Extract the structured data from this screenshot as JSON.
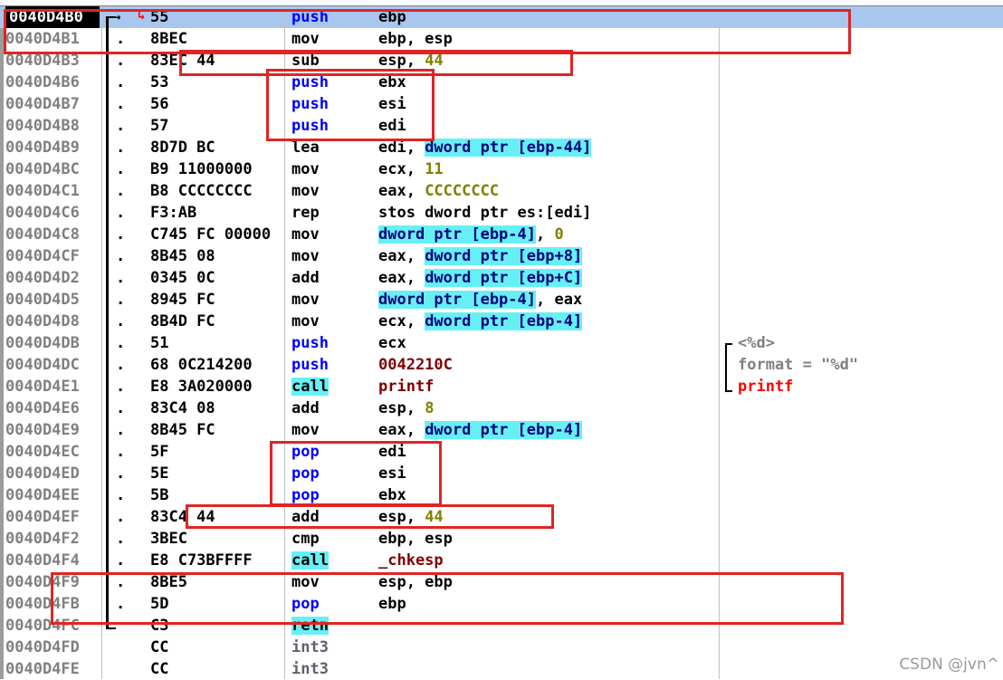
{
  "rows": [
    {
      "addr": "0040D4B0",
      "dot": "",
      "hex": "55",
      "mnem": "push",
      "ops": "ebp",
      "selected": true
    },
    {
      "addr": "0040D4B1",
      "dot": ".",
      "hex": "8BEC",
      "mnem": "mov",
      "ops": "ebp, esp"
    },
    {
      "addr": "0040D4B3",
      "dot": ".",
      "hex": "83EC 44",
      "mnem": "sub",
      "ops": "esp, 44"
    },
    {
      "addr": "0040D4B6",
      "dot": ".",
      "hex": "53",
      "mnem": "push",
      "ops": "ebx"
    },
    {
      "addr": "0040D4B7",
      "dot": ".",
      "hex": "56",
      "mnem": "push",
      "ops": "esi"
    },
    {
      "addr": "0040D4B8",
      "dot": ".",
      "hex": "57",
      "mnem": "push",
      "ops": "edi"
    },
    {
      "addr": "0040D4B9",
      "dot": ".",
      "hex": "8D7D BC",
      "mnem": "lea",
      "ops": "edi, dword ptr [ebp-44]"
    },
    {
      "addr": "0040D4BC",
      "dot": ".",
      "hex": "B9 11000000",
      "mnem": "mov",
      "ops": "ecx, 11"
    },
    {
      "addr": "0040D4C1",
      "dot": ".",
      "hex": "B8 CCCCCCCC",
      "mnem": "mov",
      "ops": "eax, CCCCCCCC"
    },
    {
      "addr": "0040D4C6",
      "dot": ".",
      "hex": "F3:AB",
      "mnem": "rep",
      "ops": "stos dword ptr es:[edi]"
    },
    {
      "addr": "0040D4C8",
      "dot": ".",
      "hex": "C745 FC 00000",
      "mnem": "mov",
      "ops": "dword ptr [ebp-4], 0"
    },
    {
      "addr": "0040D4CF",
      "dot": ".",
      "hex": "8B45 08",
      "mnem": "mov",
      "ops": "eax, dword ptr [ebp+8]"
    },
    {
      "addr": "0040D4D2",
      "dot": ".",
      "hex": "0345 0C",
      "mnem": "add",
      "ops": "eax, dword ptr [ebp+C]"
    },
    {
      "addr": "0040D4D5",
      "dot": ".",
      "hex": "8945 FC",
      "mnem": "mov",
      "ops": "dword ptr [ebp-4], eax"
    },
    {
      "addr": "0040D4D8",
      "dot": ".",
      "hex": "8B4D FC",
      "mnem": "mov",
      "ops": "ecx, dword ptr [ebp-4]"
    },
    {
      "addr": "0040D4DB",
      "dot": ".",
      "hex": "51",
      "mnem": "push",
      "ops": "ecx",
      "comment": "<%d>"
    },
    {
      "addr": "0040D4DC",
      "dot": ".",
      "hex": "68 0C214200",
      "mnem": "push",
      "ops": "0042210C",
      "comment": "format = \"%d\""
    },
    {
      "addr": "0040D4E1",
      "dot": ".",
      "hex": "E8 3A020000",
      "mnem": "call",
      "ops": "printf",
      "comment": "printf"
    },
    {
      "addr": "0040D4E6",
      "dot": ".",
      "hex": "83C4 08",
      "mnem": "add",
      "ops": "esp, 8"
    },
    {
      "addr": "0040D4E9",
      "dot": ".",
      "hex": "8B45 FC",
      "mnem": "mov",
      "ops": "eax, dword ptr [ebp-4]"
    },
    {
      "addr": "0040D4EC",
      "dot": ".",
      "hex": "5F",
      "mnem": "pop",
      "ops": "edi"
    },
    {
      "addr": "0040D4ED",
      "dot": ".",
      "hex": "5E",
      "mnem": "pop",
      "ops": "esi"
    },
    {
      "addr": "0040D4EE",
      "dot": ".",
      "hex": "5B",
      "mnem": "pop",
      "ops": "ebx"
    },
    {
      "addr": "0040D4EF",
      "dot": ".",
      "hex": "83C4 44",
      "mnem": "add",
      "ops": "esp, 44"
    },
    {
      "addr": "0040D4F2",
      "dot": ".",
      "hex": "3BEC",
      "mnem": "cmp",
      "ops": "ebp, esp"
    },
    {
      "addr": "0040D4F4",
      "dot": ".",
      "hex": "E8 C73BFFFF",
      "mnem": "call",
      "ops": "_chkesp"
    },
    {
      "addr": "0040D4F9",
      "dot": ".",
      "hex": "8BE5",
      "mnem": "mov",
      "ops": "esp, ebp"
    },
    {
      "addr": "0040D4FB",
      "dot": ".",
      "hex": "5D",
      "mnem": "pop",
      "ops": "ebp"
    },
    {
      "addr": "0040D4FC",
      "dot": "",
      "hex": "C3",
      "mnem": "retn",
      "ops": ""
    },
    {
      "addr": "0040D4FD",
      "dot": "",
      "hex": "CC",
      "mnem": "int3",
      "ops": ""
    },
    {
      "addr": "0040D4FE",
      "dot": "",
      "hex": "CC",
      "mnem": "int3",
      "ops": ""
    }
  ],
  "jump_arrow": "→",
  "jump_marker": "↳",
  "watermark": "CSDN @jvn^",
  "colors": {
    "selection": "#a9c6ee",
    "memory_highlight": "#66f0f6",
    "annotation_box": "#e02424",
    "mnemonic_stack": "#0000ff",
    "immediate": "#808000"
  }
}
